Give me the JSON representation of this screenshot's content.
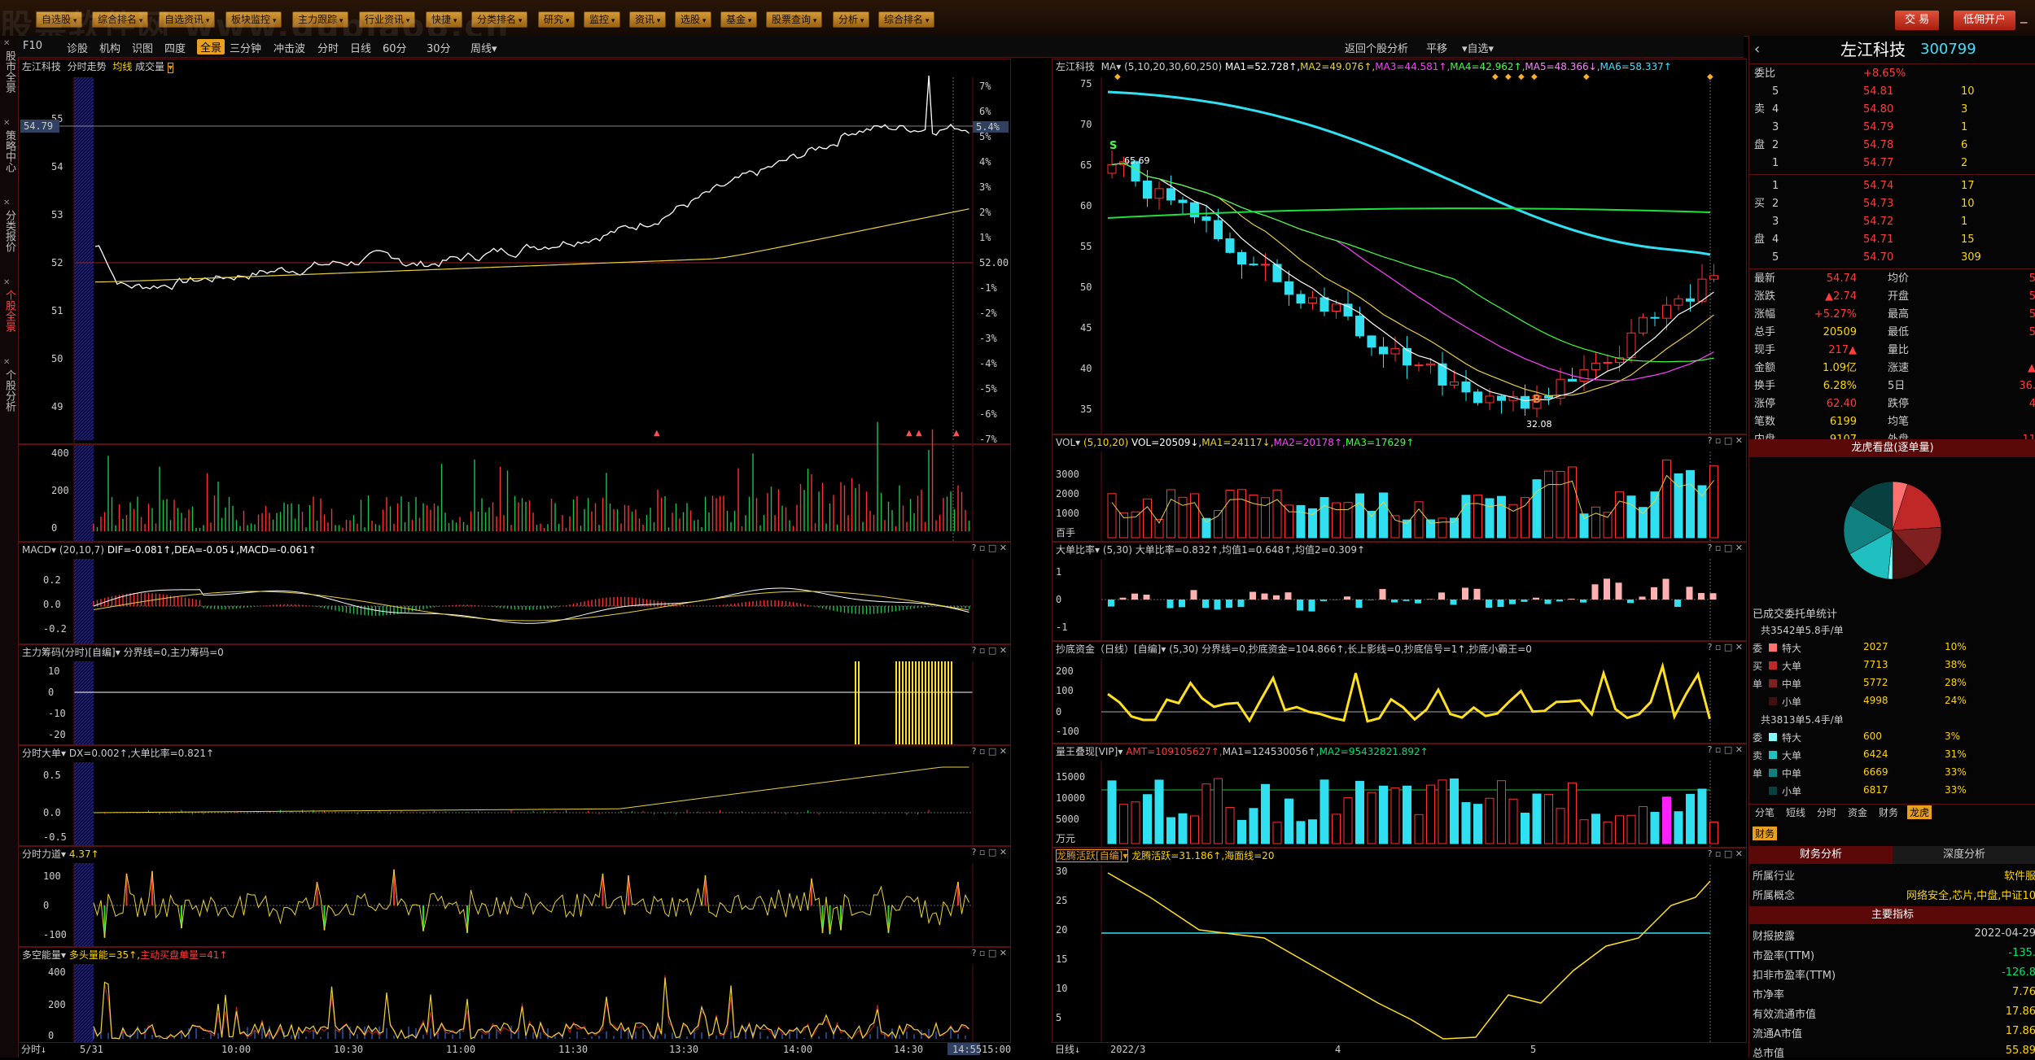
{
  "watermark": "股票软件网 www.gupiao8.cn",
  "top_menu": [
    "自选股",
    "综合排名",
    "自选资讯",
    "板块监控",
    "主力跟踪",
    "行业资讯",
    "快捷",
    "分类排名",
    "研究",
    "监控",
    "资讯",
    "选股",
    "基金",
    "股票查询",
    "分析",
    "综合排名"
  ],
  "top_right": {
    "trade": "交 易",
    "open_account": "低佣开户"
  },
  "vtabs": [
    "股市全景",
    "策略中心",
    "分类报价",
    "个股全景",
    "个股分析"
  ],
  "toolbar2": [
    "F10",
    "诊股",
    "机构",
    "识图",
    "四度",
    "全景",
    "三分钟",
    "冲击波",
    "分时",
    "日线",
    "60分",
    "30分",
    "周线▾"
  ],
  "toolbar2_right": [
    "返回个股分析",
    "平移",
    "▾自选▾"
  ],
  "left": {
    "title": "左江科技",
    "subtitle": "分时走势",
    "legend1": "均线",
    "legend2": "成交量",
    "price_label": "54.79",
    "pct_label": "5.4%",
    "base": "52.00",
    "y_left": [
      "55",
      "54",
      "53",
      "52",
      "51",
      "50",
      "49"
    ],
    "y_right": [
      "7%",
      "6%",
      "5%",
      "4%",
      "3%",
      "2%",
      "1%",
      "-1%",
      "-2%",
      "-3%",
      "-4%",
      "-5%",
      "-6%",
      "-7%"
    ],
    "vol_axis": [
      "400",
      "200",
      "0"
    ],
    "macd_title": "MACD▾",
    "macd_params": "(20,10,7)",
    "macd_vals": "DIF=-0.081↑,DEA=-0.05↓,MACD=-0.061↑",
    "macd_axis": [
      "0.2",
      "0.0",
      "-0.2"
    ],
    "zlcm_title": "主力筹码(分时)[自编]▾",
    "zlcm_vals": "分界线=0,主力筹码=0",
    "zlcm_axis": [
      "10",
      "0",
      "-10",
      "-20"
    ],
    "fsdd_title": "分时大单▾",
    "fsdd_vals": "DX=0.002↑,大单比率=0.821↑",
    "fsdd_axis": [
      "0.5",
      "0.0",
      "-0.5"
    ],
    "fsld_title": "分时力道▾",
    "fsld_vals": "4.37↑",
    "fsld_axis": [
      "100",
      "0",
      "-100"
    ],
    "dkn_title": "多空能量▾",
    "dkn_vals1": "多头量能=35↑,",
    "dkn_vals2": "主动买盘单量=41↑",
    "dkn_axis": [
      "400",
      "200",
      "0"
    ],
    "x_mode": "分时",
    "x_labels": [
      "5/31",
      "10:00",
      "10:30",
      "11:00",
      "11:30",
      "13:30",
      "14:00",
      "14:30",
      "14:55",
      "15:00"
    ]
  },
  "mid": {
    "title": "左江科技",
    "ma_label": "MA▾",
    "ma_params": "(5,10,20,30,60,250)",
    "ma_vals": [
      "MA1=52.728↑,",
      "MA2=49.076↑,",
      "MA3=44.581↑,",
      "MA4=42.962↑,",
      "MA5=48.366↓,",
      "MA6=58.337↑"
    ],
    "y_axis": [
      "75",
      "70",
      "65",
      "60",
      "55",
      "50",
      "45",
      "40",
      "35"
    ],
    "high_label": "65.69",
    "low_label": "32.08",
    "s_label": "S",
    "b_label": "B",
    "vol_title": "VOL▾",
    "vol_params": "(5,10,20)",
    "vol_vals": [
      "VOL=20509↓,",
      "MA1=24117↓,",
      "MA2=20178↑,",
      "MA3=17629↑"
    ],
    "vol_axis": [
      "3000",
      "2000",
      "1000",
      "百手"
    ],
    "ddbl_title": "大单比率▾",
    "ddbl_params": "(5,30)",
    "ddbl_vals": "大单比率=0.832↑,均值1=0.648↑,均值2=0.309↑",
    "ddbl_axis": [
      "1",
      "0",
      "-1"
    ],
    "cdzj_title": "抄底资金（日线）[自编]▾",
    "cdzj_params": "(5,30)",
    "cdzj_vals": "分界线=0,抄底资金=104.866↑,长上影线=0,抄底信号=1↑,抄底小霸王=0",
    "cdzj_axis": [
      "200",
      "100",
      "0",
      "-100"
    ],
    "lwdx_title": "量王叠现[VIP]▾",
    "lwdx_vals1": "AMT=109105627↑,",
    "lwdx_vals2": "MA1=124530056↑,",
    "lwdx_vals3": "MA2=95432821.892↑",
    "lwdx_axis": [
      "15000",
      "10000",
      "5000",
      "万元"
    ],
    "lthy_title": "龙腾活跃[自编]▾",
    "lthy_vals": "龙腾活跃=31.186↑,海面线=20",
    "lthy_axis": [
      "30",
      "25",
      "20",
      "15",
      "10",
      "5"
    ],
    "x_mode": "日线",
    "x_labels": [
      "2022/3",
      "4",
      "5"
    ]
  },
  "right": {
    "name": "左江科技",
    "code": "300799",
    "webi_label": "委比",
    "webi_val": "+8.65%",
    "sell": [
      [
        "5",
        "54.81",
        "10"
      ],
      [
        "4",
        "54.80",
        "3"
      ],
      [
        "3",
        "54.79",
        "1"
      ],
      [
        "2",
        "54.78",
        "6"
      ],
      [
        "1",
        "54.77",
        "2"
      ]
    ],
    "buy": [
      [
        "1",
        "54.74",
        "17"
      ],
      [
        "2",
        "54.73",
        "10"
      ],
      [
        "3",
        "54.72",
        "1"
      ],
      [
        "4",
        "54.71",
        "15"
      ],
      [
        "5",
        "54.70",
        "309"
      ]
    ],
    "side_sell": "卖",
    "side_buy": "买",
    "side_pan": "盘",
    "quote": [
      [
        "最新",
        "54.74",
        "均价",
        "5"
      ],
      [
        "涨跌",
        "▲2.74",
        "开盘",
        "5"
      ],
      [
        "涨幅",
        "+5.27%",
        "最高",
        "5"
      ],
      [
        "总手",
        "20509",
        "最低",
        "5"
      ],
      [
        "现手",
        "217▲",
        "量比",
        ""
      ],
      [
        "金额",
        "1.09亿",
        "涨速",
        "▲"
      ],
      [
        "换手",
        "6.28%",
        "5日",
        "36."
      ],
      [
        "涨停",
        "62.40",
        "跌停",
        "4"
      ],
      [
        "笔数",
        "6199",
        "均笔",
        ""
      ],
      [
        "内盘",
        "9107",
        "外盘",
        "11"
      ]
    ],
    "pie_title": "龙虎看盘(逐单量)",
    "entrust_title": "已成交委托单统计",
    "buy_total": "共3542单5.8手/单",
    "buy_rows": [
      [
        "特大",
        "2027",
        "10%"
      ],
      [
        "大单",
        "7713",
        "38%"
      ],
      [
        "中单",
        "5772",
        "28%"
      ],
      [
        "小单",
        "4998",
        "24%"
      ]
    ],
    "buy_side": [
      "委",
      "买",
      "单"
    ],
    "sell_total": "共3813单5.4手/单",
    "sell_rows": [
      [
        "特大",
        "600",
        "3%"
      ],
      [
        "大单",
        "6424",
        "31%"
      ],
      [
        "中单",
        "6669",
        "33%"
      ],
      [
        "小单",
        "6817",
        "33%"
      ]
    ],
    "sell_side": [
      "委",
      "卖",
      "单"
    ],
    "tabs1": [
      "分笔",
      "短线",
      "分时",
      "资金",
      "财务",
      "龙虎"
    ],
    "tabs2": [
      "财务"
    ],
    "sub_tabs": [
      "财务分析",
      "深度分析"
    ],
    "industry_label": "所属行业",
    "industry_val": "软件服",
    "concept_label": "所属概念",
    "concept_val": "网络安全,芯片,中盘,中证10",
    "main_index": "主要指标",
    "fin": [
      [
        "财报披露",
        "2022-04-29"
      ],
      [
        "市盈率(TTM)",
        "-135."
      ],
      [
        "扣非市盈率(TTM)",
        "-126.8"
      ],
      [
        "市净率",
        "7.76"
      ],
      [
        "有效流通市值",
        "17.86"
      ],
      [
        "流通A市值",
        "17.86"
      ],
      [
        "总市值",
        "55.89"
      ]
    ]
  }
}
